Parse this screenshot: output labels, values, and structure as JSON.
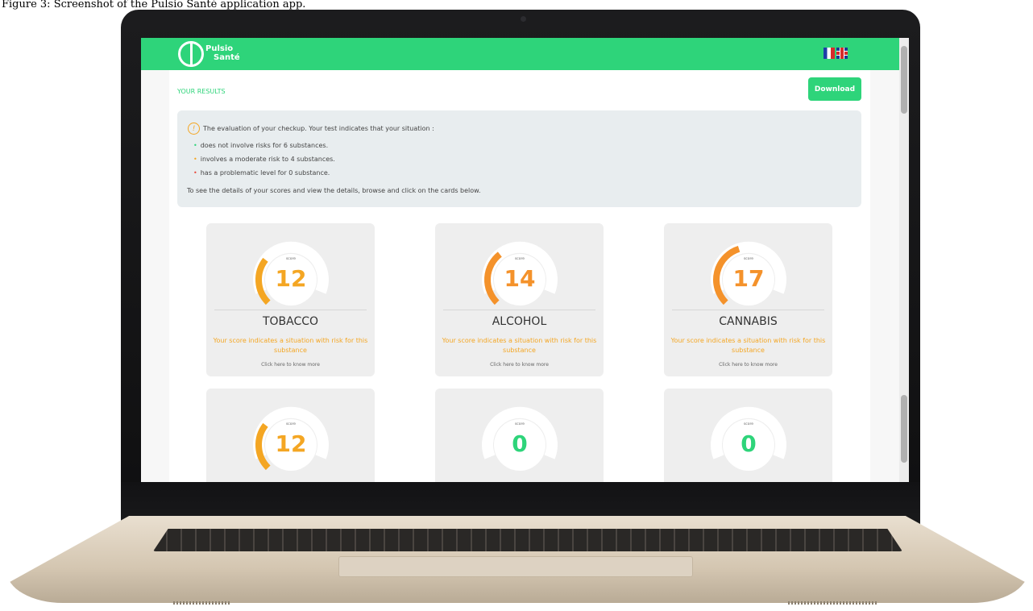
{
  "caption": "Figure 3: Screenshot of the Pulsio Santé application app.",
  "app": {
    "logo_line1": "Pulsio",
    "logo_line2": "Santé",
    "languages": [
      "FR",
      "EN"
    ]
  },
  "results": {
    "title": "YOUR RESULTS",
    "download_label": "Download",
    "info_icon": "!",
    "intro": "The evaluation of your checkup. Your test indicates that your situation :",
    "items": [
      "does not involve risks for 6 substances.",
      "involves a moderate risk to 4 substances.",
      "has a problematic level for 0 substance."
    ],
    "footer": "To see the details of your scores and view the details, browse and click on the cards below."
  },
  "cards": [
    {
      "score_label": "score",
      "score": "12",
      "score_value": 12,
      "name": "TOBACCO",
      "message": "Your score indicates a situation with risk for this substance",
      "link": "Click here to know more",
      "color": "#f4a623"
    },
    {
      "score_label": "score",
      "score": "14",
      "score_value": 14,
      "name": "ALCOHOL",
      "message": "Your score indicates a situation with risk for this substance",
      "link": "Click here to know more",
      "color": "#f4922b"
    },
    {
      "score_label": "score",
      "score": "17",
      "score_value": 17,
      "name": "CANNABIS",
      "message": "Your score indicates a situation with risk for this substance",
      "link": "Click here to know more",
      "color": "#f4922b"
    },
    {
      "score_label": "score",
      "score": "12",
      "score_value": 12,
      "name": "",
      "message": "",
      "link": "",
      "color": "#f4a623"
    },
    {
      "score_label": "score",
      "score": "0",
      "score_value": 0,
      "name": "",
      "message": "",
      "link": "",
      "color": "#2ed47a"
    },
    {
      "score_label": "score",
      "score": "0",
      "score_value": 0,
      "name": "",
      "message": "",
      "link": "",
      "color": "#2ed47a"
    }
  ],
  "colors": {
    "brand": "#2ed47a",
    "moderate": "#f4a623",
    "risk": "#f4922b",
    "safe": "#2ed47a"
  }
}
